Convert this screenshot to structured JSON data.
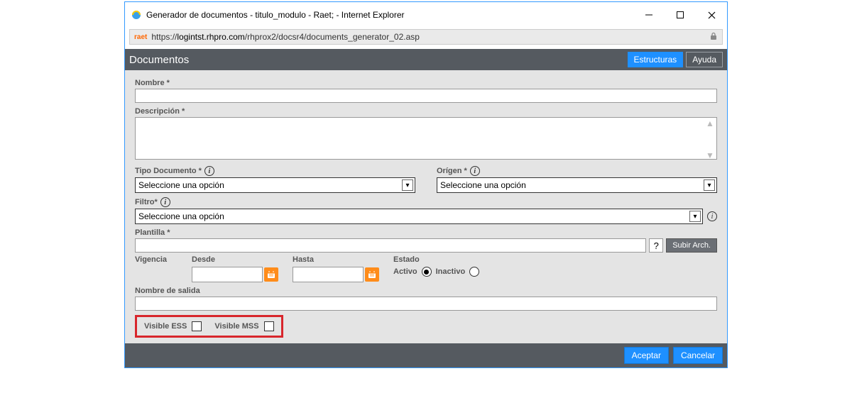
{
  "window": {
    "title": "Generador de documentos - titulo_modulo - Raet; - Internet Explorer"
  },
  "address": {
    "favicon_text": "raet",
    "protocol": "https://",
    "domain": "logintst.rhpro.com",
    "path": "/rhprox2/docsr4/documents_generator_02.asp"
  },
  "header": {
    "title": "Documentos",
    "btn_estructuras": "Estructuras",
    "btn_ayuda": "Ayuda"
  },
  "form": {
    "nombre_label": "Nombre *",
    "descripcion_label": "Descripción *",
    "tipo_doc_label": "Tipo Documento *",
    "origen_label": "Orígen *",
    "filtro_label": "Filtro*",
    "plantilla_label": "Plantilla *",
    "select_placeholder": "Seleccione una opción",
    "qmark": "?",
    "subir_arch": "Subir Arch.",
    "vigencia_label": "Vigencia",
    "desde_label": "Desde",
    "hasta_label": "Hasta",
    "estado_label": "Estado",
    "activo_label": "Activo",
    "inactivo_label": "Inactivo",
    "nombre_salida_label": "Nombre de salida",
    "visible_ess": "Visible ESS",
    "visible_mss": "Visible MSS"
  },
  "footer": {
    "aceptar": "Aceptar",
    "cancelar": "Cancelar"
  }
}
